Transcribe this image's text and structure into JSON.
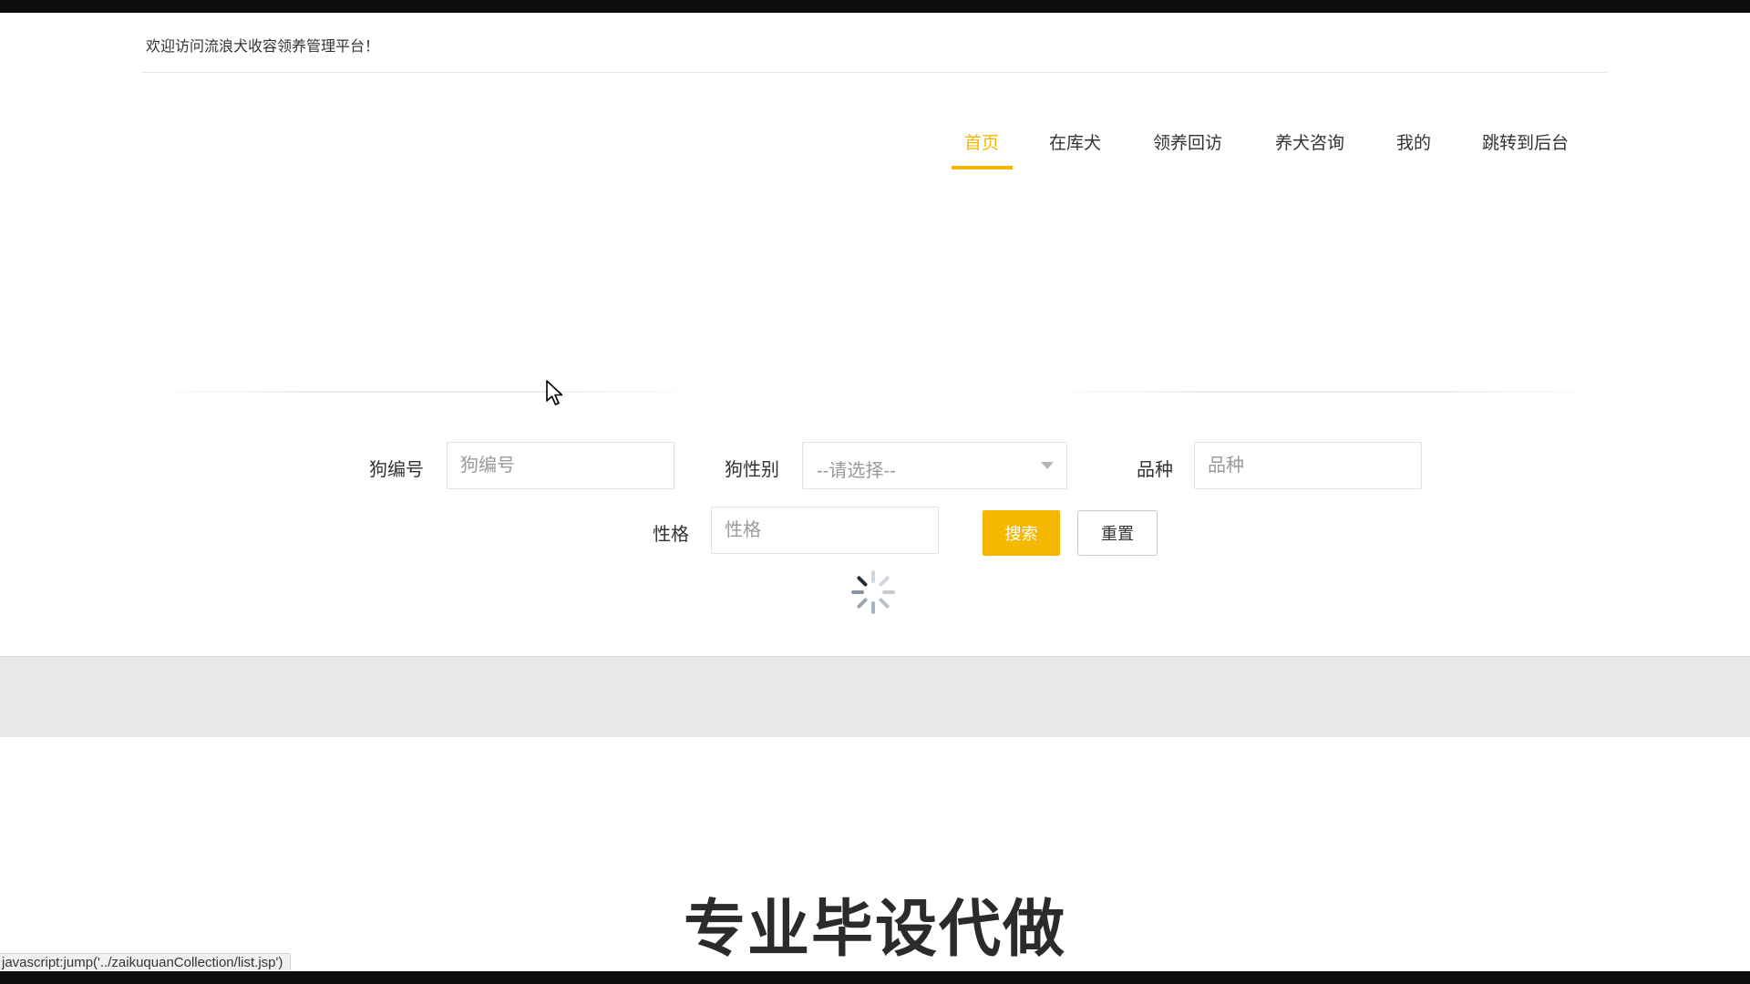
{
  "header": {
    "welcome_text": "欢迎访问流浪犬收容领养管理平台！"
  },
  "nav": {
    "items": [
      {
        "label": "首页",
        "active": true
      },
      {
        "label": "在库犬",
        "active": false
      },
      {
        "label": "领养回访",
        "active": false
      },
      {
        "label": "养犬咨询",
        "active": false
      },
      {
        "label": "我的",
        "active": false
      },
      {
        "label": "跳转到后台",
        "active": false
      }
    ]
  },
  "search": {
    "dog_number": {
      "label": "狗编号",
      "placeholder": "狗编号",
      "value": ""
    },
    "dog_gender": {
      "label": "狗性别",
      "selected": "--请选择--"
    },
    "breed": {
      "label": "品种",
      "placeholder": "品种",
      "value": ""
    },
    "temperament": {
      "label": "性格",
      "placeholder": "性格",
      "value": ""
    },
    "search_button": "搜索",
    "reset_button": "重置"
  },
  "overlay": {
    "caption": "专业毕设代做"
  },
  "status_bar": {
    "url": "javascript:jump('../zaikuquanCollection/list.jsp')"
  },
  "colors": {
    "accent": "#f5b800",
    "text": "#333333",
    "placeholder": "#9a9a9a"
  }
}
